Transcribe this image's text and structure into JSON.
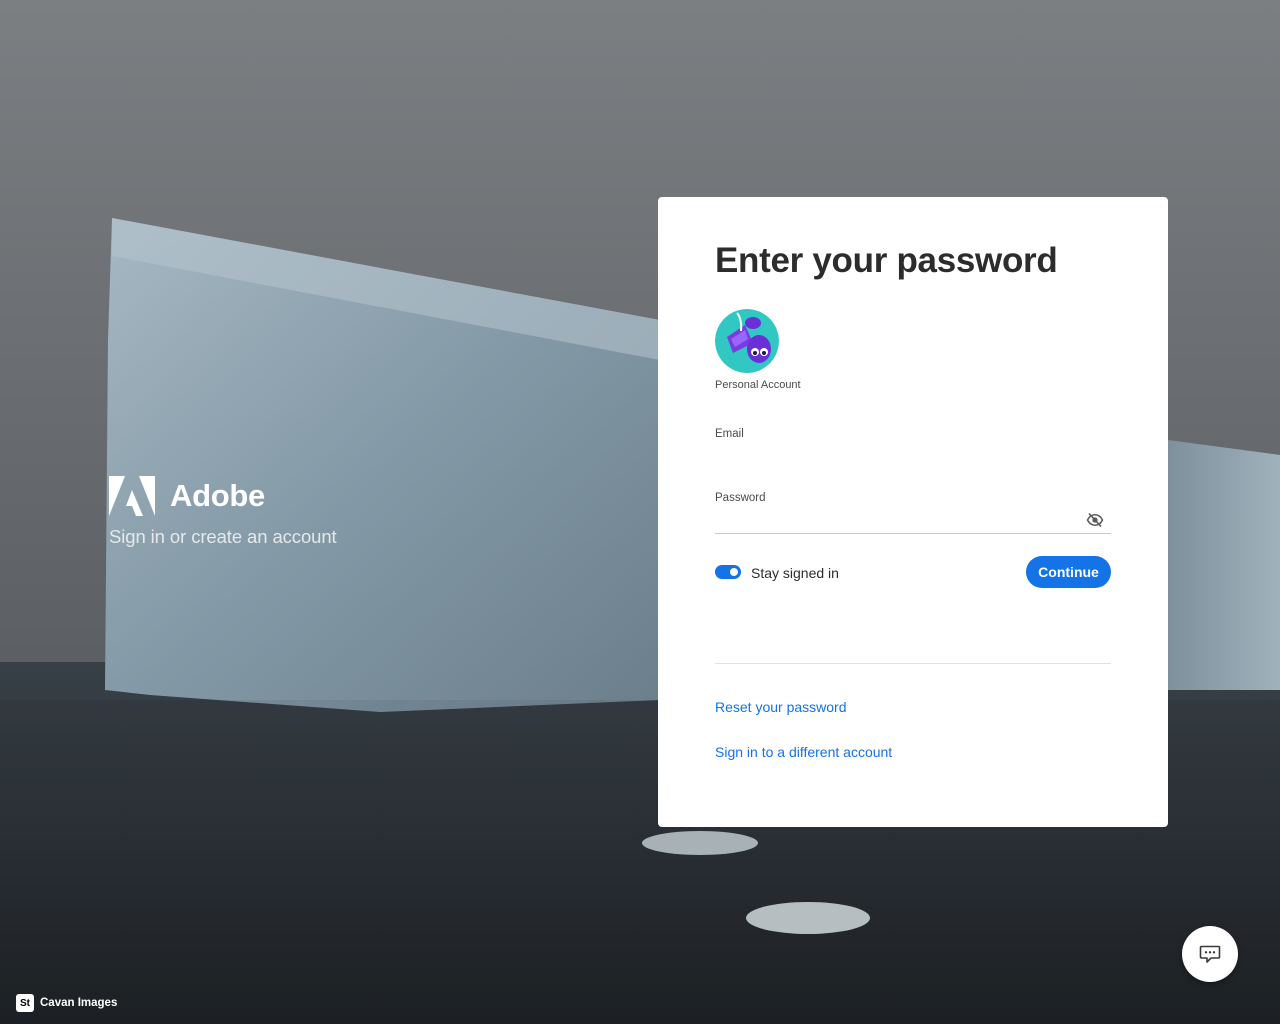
{
  "background": {
    "description_icon": "iceberg-background",
    "sky_color": "#6e7174",
    "sea_color": "#2d3338",
    "ice_color": "#9aaeb9"
  },
  "brand": {
    "name": "Adobe",
    "tagline": "Sign in or create an account",
    "logo_icon": "adobe-logo"
  },
  "card": {
    "title": "Enter your password",
    "account": {
      "avatar_icon": "avatar",
      "label": "Personal Account"
    },
    "email": {
      "label": "Email",
      "value": ""
    },
    "password": {
      "label": "Password",
      "value": "",
      "visibility_icon": "eye-slash-icon"
    },
    "stay_signed_in": {
      "label": "Stay signed in",
      "checked": true
    },
    "continue_label": "Continue",
    "reset_link": "Reset your password",
    "switch_account_link": "Sign in to a different account"
  },
  "footer": {
    "credit_badge": "St",
    "credit_text": "Cavan Images",
    "chat_icon": "chat-icon"
  },
  "colors": {
    "accent": "#1473e6",
    "title_text": "#2c2c2c",
    "card_bg": "#ffffff",
    "avatar_bg": "#31c7c2"
  }
}
